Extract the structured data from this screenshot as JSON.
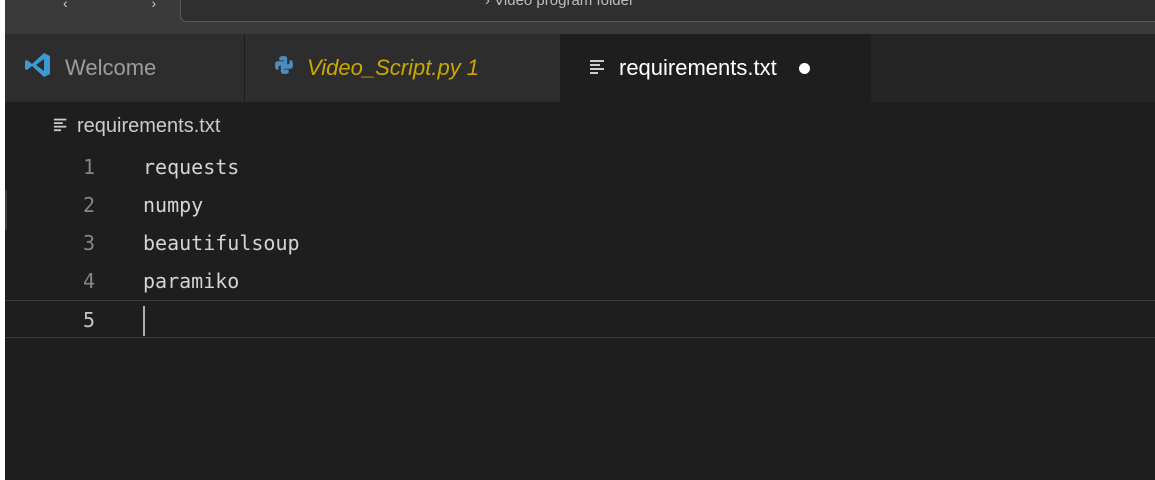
{
  "titlebar": {
    "nav_arrows": "‹ ›",
    "command_center_text": "› Video program folder"
  },
  "tabs": [
    {
      "label": "Welcome",
      "icon": "vscode-logo-icon"
    },
    {
      "label": "Video_Script.py 1",
      "icon": "python-icon"
    },
    {
      "label": "requirements.txt",
      "icon": "text-file-icon",
      "dirty": true
    }
  ],
  "breadcrumb": {
    "label": "requirements.txt",
    "icon": "text-file-icon"
  },
  "editor": {
    "lines": [
      {
        "number": "1",
        "text": "requests"
      },
      {
        "number": "2",
        "text": "numpy"
      },
      {
        "number": "3",
        "text": "beautifulsoup"
      },
      {
        "number": "4",
        "text": "paramiko"
      },
      {
        "number": "5",
        "text": ""
      }
    ]
  },
  "colors": {
    "editor_bg": "#1e1e1e",
    "tab_inactive_bg": "#2d2d2d",
    "warning_tab_text": "#cca700",
    "vscode_blue": "#3c99d4",
    "python_blue": "#4b8bbe"
  }
}
